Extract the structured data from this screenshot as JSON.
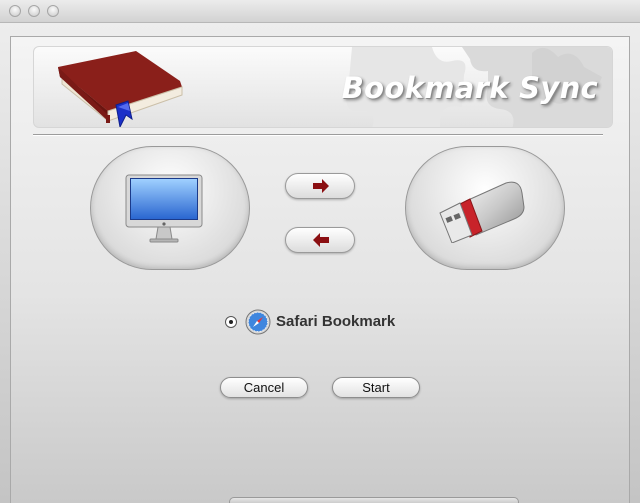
{
  "window": {
    "title": "",
    "controls": [
      "close-icon",
      "minimize-icon",
      "zoom-icon"
    ]
  },
  "banner": {
    "title": "Bookmark Sync",
    "icon": "book-icon"
  },
  "sync": {
    "left_device_icon": "imac-icon",
    "right_device_icon": "usb-drive-icon",
    "to_device_icon": "arrow-right-icon",
    "from_device_icon": "arrow-left-icon"
  },
  "source": {
    "label": "Safari Bookmark",
    "icon": "safari-icon",
    "selected": true
  },
  "buttons": {
    "cancel_label": "Cancel",
    "start_label": "Start"
  },
  "colors": {
    "arrow": "#8b0f12",
    "usb_band": "#c8232a",
    "bookmark_ribbon": "#1a2fc9",
    "book": "#8a1f1a"
  }
}
